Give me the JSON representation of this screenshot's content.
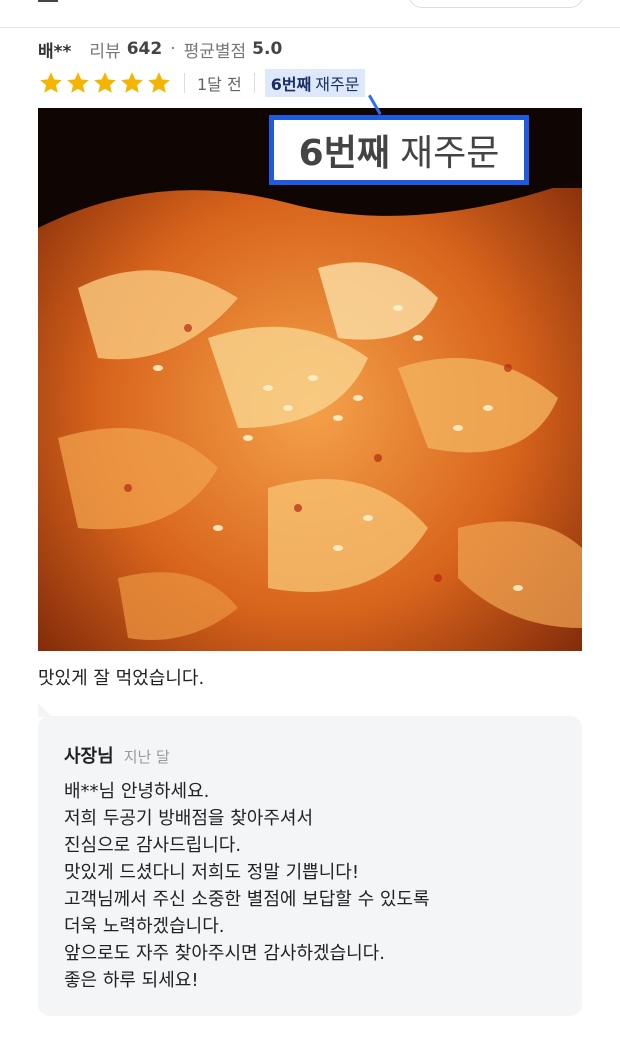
{
  "review": {
    "reviewer": "배**",
    "stats_review_label": "리뷰",
    "stats_review_count": "642",
    "stats_separator": "·",
    "stats_rating_label": "평균별점",
    "stats_rating_value": "5.0",
    "rating": 5,
    "date": "1달 전",
    "reorder_count": "6번째",
    "reorder_label": "재주문",
    "text": "맛있게 잘 먹었습니다."
  },
  "callout": {
    "count": "6번째",
    "label": "재주문"
  },
  "owner_reply": {
    "label": "사장님",
    "date": "지난 달",
    "lines": [
      "배**님 안녕하세요.",
      "저희 두공기 방배점을 찾아주셔서",
      "진심으로 감사드립니다.",
      "맛있게 드셨다니 저희도 정말 기쁩니다!",
      "고객님께서 주신 소중한 별점에 보답할 수 있도록",
      "더욱 노력하겠습니다.",
      "앞으로도 자주 찾아주시면 감사하겠습니다.",
      "좋은 하루 되세요!"
    ]
  },
  "colors": {
    "star": "#f5b400",
    "badge_bg": "#dde9fa",
    "callout_border": "#1f5be0",
    "reply_bg": "#f4f5f7"
  },
  "icons": {
    "star": "star-icon",
    "menu": "menu-icon"
  }
}
